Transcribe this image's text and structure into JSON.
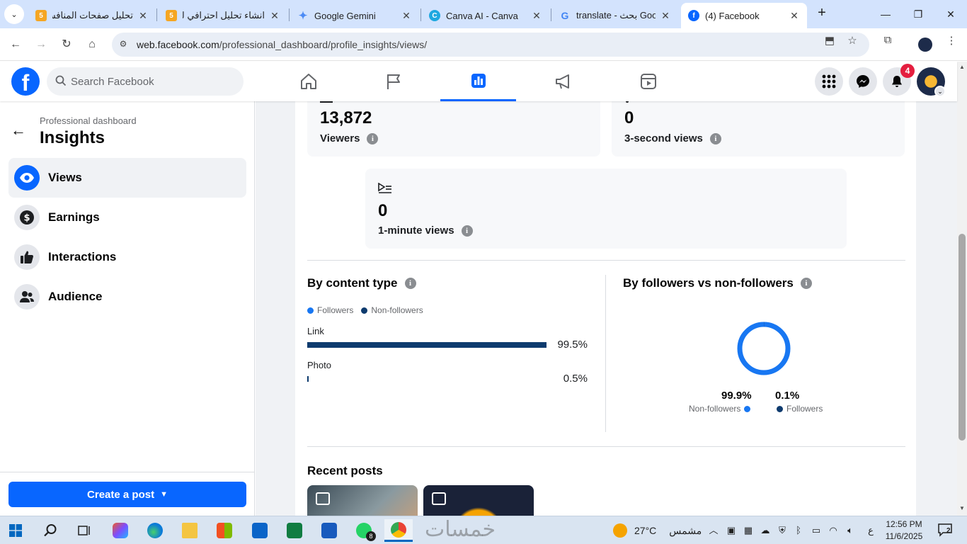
{
  "browser": {
    "tabs": [
      {
        "title": "تحليل صفحات المنافسة",
        "favicon_text": "5",
        "favicon_color": "#f5a623"
      },
      {
        "title": "انشاء تحليل احترافي لـ",
        "favicon_text": "5",
        "favicon_color": "#f5a623"
      },
      {
        "title": "Google Gemini",
        "favicon_text": "✦",
        "favicon_color": "#4c8bf5"
      },
      {
        "title": "Canva AI - Canva",
        "favicon_text": "C",
        "favicon_color": "#1fa8e0"
      },
      {
        "title": "translate - بحث Google",
        "favicon_text": "G",
        "favicon_color": "#4285f4"
      },
      {
        "title": "(4) Facebook",
        "favicon_text": "f",
        "favicon_color": "#0866ff"
      }
    ],
    "url_domain": "web.facebook.com",
    "url_path": "/professional_dashboard/profile_insights/views/"
  },
  "fb": {
    "logo": "f",
    "search_placeholder": "Search Facebook",
    "notification_count": "4"
  },
  "sidebar": {
    "breadcrumb": "Professional dashboard",
    "title": "Insights",
    "items": [
      {
        "label": "Views",
        "icon": "eye-icon"
      },
      {
        "label": "Earnings",
        "icon": "dollar-icon"
      },
      {
        "label": "Interactions",
        "icon": "thumbs-up-icon"
      },
      {
        "label": "Audience",
        "icon": "people-icon"
      }
    ],
    "create_post": "Create a post"
  },
  "metrics": {
    "viewers": {
      "value": "13,872",
      "label": "Viewers"
    },
    "three_sec": {
      "value": "0",
      "label": "3-second views"
    },
    "one_min": {
      "value": "0",
      "label": "1-minute views"
    }
  },
  "content_type": {
    "title": "By content type",
    "legend": [
      "Followers",
      "Non-followers"
    ],
    "colors": {
      "followers": "#1877f2",
      "non_followers": "#0e3b6e"
    },
    "rows": [
      {
        "label": "Link",
        "value": 99.5,
        "pct": "99.5%"
      },
      {
        "label": "Photo",
        "value": 0.5,
        "pct": "0.5%"
      }
    ]
  },
  "followers_split": {
    "title": "By followers vs non-followers",
    "non_followers": {
      "pct": "99.9%",
      "label": "Non-followers",
      "value": 99.9
    },
    "followers": {
      "pct": "0.1%",
      "label": "Followers",
      "value": 0.1
    }
  },
  "recent_posts": {
    "title": "Recent posts"
  },
  "taskbar": {
    "watermark": "خمسات",
    "temperature": "27°C",
    "weather": "مشمس",
    "lang": "ع",
    "time": "12:56 PM",
    "date": "11/6/2025",
    "notif_count": "2",
    "whatsapp_badge": "8"
  }
}
